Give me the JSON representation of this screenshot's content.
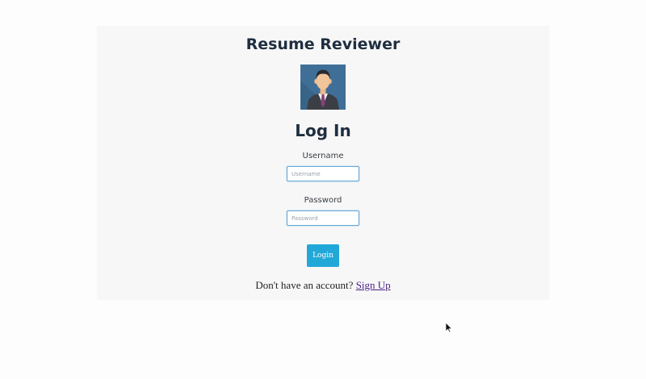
{
  "app": {
    "title": "Resume Reviewer"
  },
  "login": {
    "heading": "Log In",
    "username_label": "Username",
    "username_placeholder": "Username",
    "username_value": "",
    "password_label": "Password",
    "password_placeholder": "Password",
    "password_value": "",
    "button_label": "Login"
  },
  "signup": {
    "prompt": "Don't have an account?",
    "link_label": "Sign Up"
  },
  "colors": {
    "heading": "#1f2e40",
    "button": "#22a8d8",
    "input_border": "#62a6d3",
    "link": "#4b1f86",
    "card_background": "#f7f7f7"
  },
  "icons": {
    "avatar": "businessman-avatar-icon",
    "pointer": "mouse-cursor-icon"
  }
}
